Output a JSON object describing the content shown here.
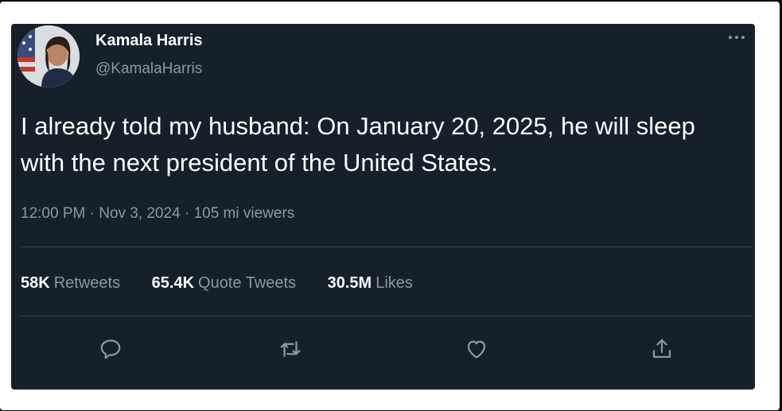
{
  "tweet": {
    "author_name": "Kamala Harris",
    "author_handle": "@KamalaHarris",
    "text": "I already told my husband: On January 20, 2025, he will sleep with the next president of the United States.",
    "time": "12:00 PM",
    "date": "Nov 3, 2024",
    "viewers": "105 mi viewers",
    "separator": "·"
  },
  "stats": {
    "retweets_count": "58K",
    "retweets_label": "Retweets",
    "quotes_count": "65.4K",
    "quotes_label": "Quote Tweets",
    "likes_count": "30.5M",
    "likes_label": "Likes"
  },
  "icons": {
    "reply": "reply-icon",
    "retweet": "retweet-icon",
    "like": "heart-icon",
    "share": "share-icon",
    "more": "more-icon"
  },
  "colors": {
    "background": "#15202b",
    "text_primary": "#ffffff",
    "text_secondary": "#8899a6",
    "divider": "#38444d"
  }
}
